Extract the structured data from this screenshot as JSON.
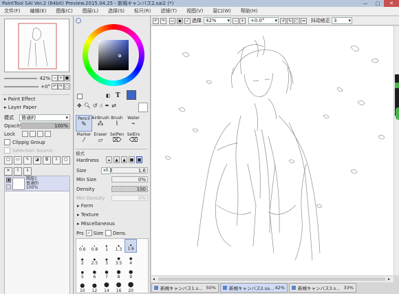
{
  "window": {
    "title": "PaintTool SAI Ver.2 (64bit) Preview.2015.04.25 - 新規キャンバス2.sai2 (*)",
    "minimize": "—",
    "maximize": "□",
    "close": "✕"
  },
  "menu": [
    "文件(F)",
    "编辑(E)",
    "图像(C)",
    "图层(L)",
    "选择(S)",
    "标尺(R)",
    "滤镜(T)",
    "视图(V)",
    "窗口(W)",
    "帮助(H)"
  ],
  "navigator": {
    "zoom": "42%",
    "angle": "+0°"
  },
  "layer_props": {
    "paint_effect": "Paint Effect",
    "layer_paper": "Layer Paper",
    "mode_label": "模式",
    "mode_value": "普通的",
    "opacity_label": "Opacity",
    "opacity_value": "100%",
    "lock_label": "Lock",
    "clipping": "Clippig Group",
    "selection_source": "Selection Source"
  },
  "layer": {
    "name": "图层1",
    "mode": "普通的",
    "opacity": "100%"
  },
  "toolbar": {
    "select_label": "选择",
    "zoom": "42%",
    "angle": "+0.0°",
    "stabilizer_label": "抖动修正",
    "stabilizer_value": "3"
  },
  "tools": [
    "Pencil",
    "AirBrush",
    "Brush",
    "Water",
    "Marker",
    "Eraser",
    "SelPen",
    "SelErs"
  ],
  "brush": {
    "mode": "模式",
    "hardness": "Hardness",
    "size_label": "Size",
    "size_mult": "x0.1",
    "size_value": "1.6",
    "min_size_label": "Min Size",
    "min_size_value": "0%",
    "density_label": "Density",
    "density_value": "100",
    "min_density_label": "Min Density",
    "min_density_value": "0%",
    "form": "Form",
    "texture": "Texture",
    "misc": "Miscellaneous",
    "prs": "Prs",
    "size_chk": "Size",
    "dens": "Dens."
  },
  "size_presets": [
    "0.6",
    "0.8",
    "1",
    "1.3",
    "1.6",
    "2",
    "2.5",
    "3",
    "3.5",
    "4",
    "5",
    "6",
    "7",
    "8",
    "9",
    "10",
    "12",
    "14",
    "16",
    "20"
  ],
  "tabs": [
    {
      "name": "新規キャンバス1.s...",
      "zoom": "50%"
    },
    {
      "name": "新規キャンバス2.sa...",
      "zoom": "42%"
    },
    {
      "name": "新規キャンバス3.s...",
      "zoom": "33%"
    }
  ],
  "colors": {
    "primary": "#3c66c4",
    "accent": "#b7c7db"
  }
}
